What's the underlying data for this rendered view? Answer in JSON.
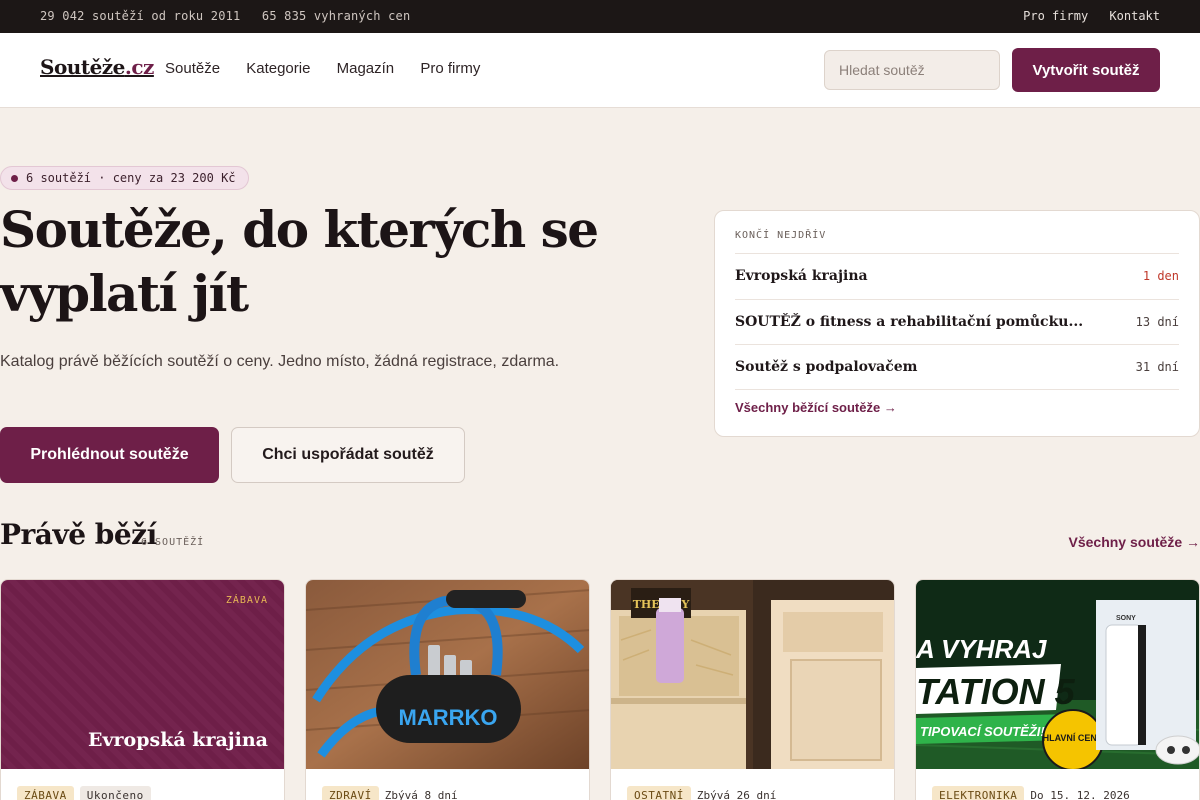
{
  "topbar": {
    "stat_contests": "29 042 soutěží od roku 2011",
    "stat_prizes": "65 835 vyhraných cen",
    "link_business": "Pro firmy",
    "link_contact": "Kontakt"
  },
  "header": {
    "logo_main": "Soutěže",
    "logo_tld": ".cz",
    "nav": [
      "Soutěže",
      "Kategorie",
      "Magazín",
      "Pro firmy"
    ],
    "search_placeholder": "Hledat soutěž",
    "create_label": "Vytvořit soutěž"
  },
  "hero": {
    "pill": "6 soutěží · ceny za 23 200 Kč",
    "title": "Soutěže, do kterých se vyplatí jít",
    "subtitle": "Katalog právě běžících soutěží o ceny. Jedno místo, žádná registrace, zdarma.",
    "btn_primary": "Prohlédnout soutěže",
    "btn_secondary": "Chci uspořádat soutěž"
  },
  "ending": {
    "label": "KONČÍ NEJDŘÍV",
    "items": [
      {
        "name": "Evropská krajina",
        "left": "1 den"
      },
      {
        "name": "SOUTĚŽ o fitness a rehabilitační pomůcku...",
        "left": "13 dní"
      },
      {
        "name": "Soutěž s podpalovačem",
        "left": "31 dní"
      }
    ],
    "all_link": "Všechny běžící soutěže →"
  },
  "section": {
    "title": "Právě běží",
    "count": "6 SOUTĚŽÍ",
    "all_link": "Všechny soutěže →"
  },
  "cards": [
    {
      "category": "ZÁBAVA",
      "title": "Evropská krajina",
      "tag": "ZÁBAVA",
      "status": "Ukončeno"
    },
    {
      "tag": "ZDRAVÍ",
      "status": "Zbývá 8 dní",
      "brand": "MARRKO"
    },
    {
      "tag": "OSTATNÍ",
      "status": "Zbývá 26 dní",
      "box_label": "THE KEY"
    },
    {
      "tag": "ELEKTRONIKA",
      "status": "Do 15. 12. 2026",
      "banner_line1": "A VYHRAJ",
      "banner_line2": "TATION 5",
      "banner_line3": "TIPOVACÍ SOUTĚŽI!",
      "badge": "HLAVNÍ CENA",
      "sony": "SONY"
    }
  ]
}
